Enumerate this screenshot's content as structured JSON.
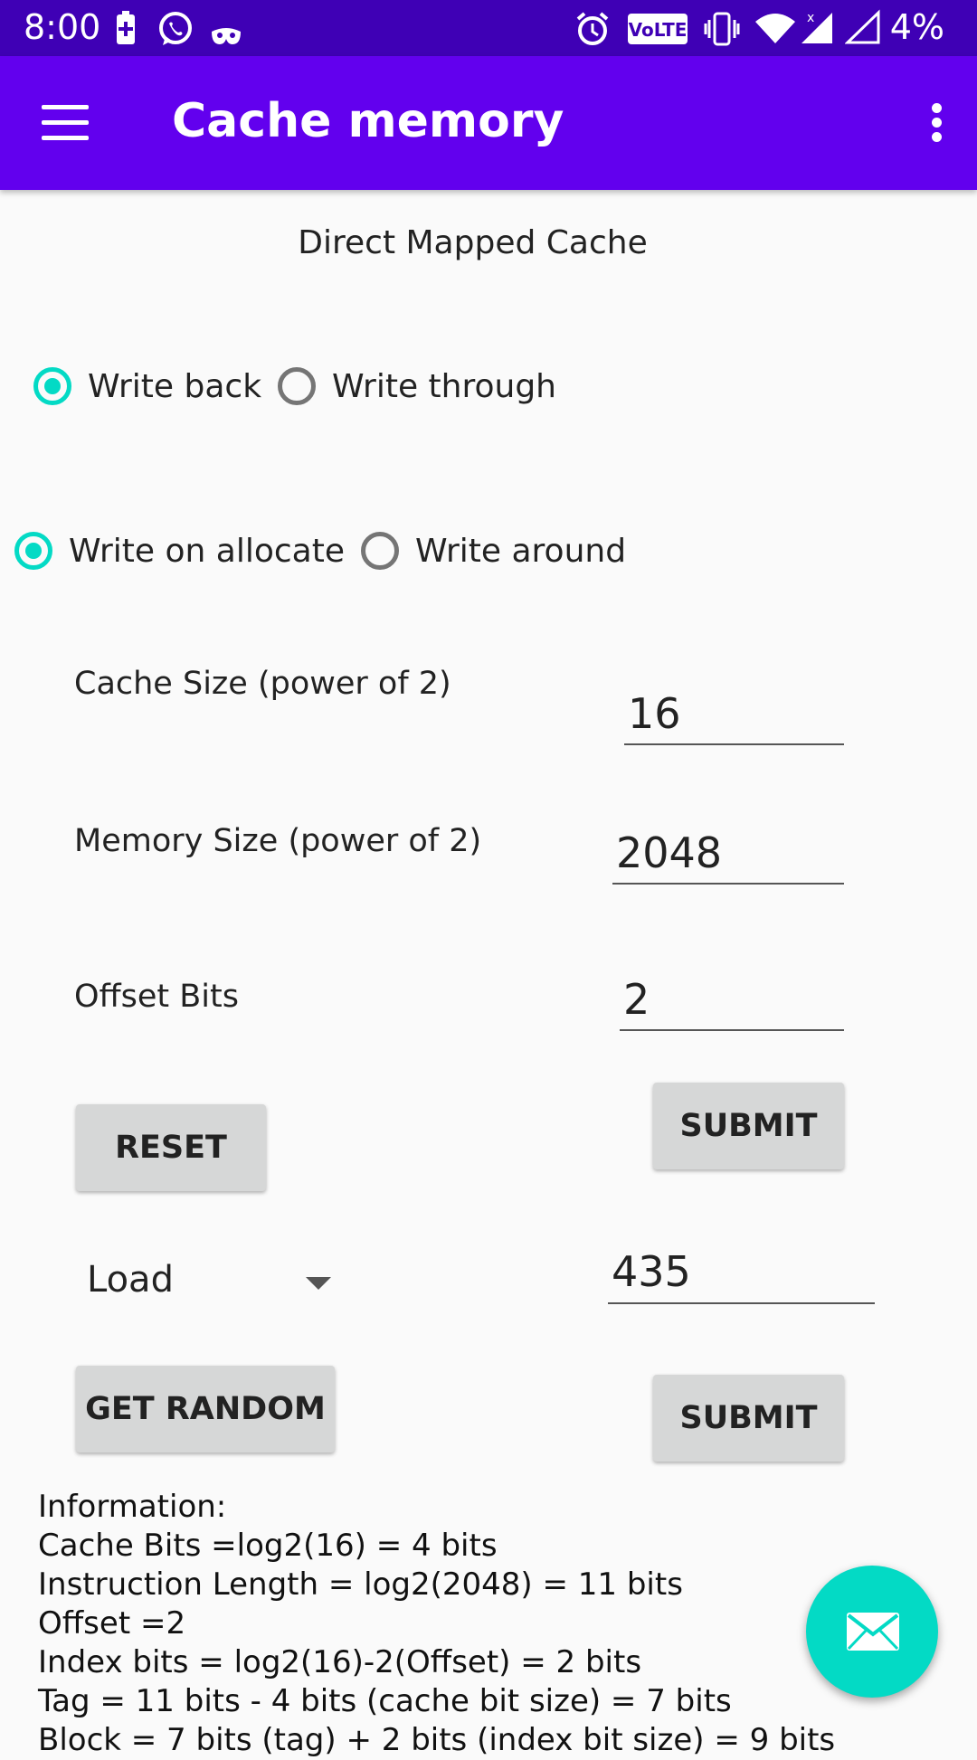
{
  "status_bar": {
    "time": "8:00",
    "battery_percent": "4%",
    "volte_label": "VoLTE",
    "icons": [
      "battery-saver-icon",
      "whatsapp-icon",
      "incognito-icon",
      "alarm-icon",
      "volte-icon",
      "vibrate-icon",
      "wifi-icon",
      "cellular-signal-icon",
      "signal-empty-icon"
    ]
  },
  "app_bar": {
    "title": "Cache memory",
    "background_color": "#6200ee",
    "status_color": "#3f00b5"
  },
  "main": {
    "section_title": "Direct Mapped Cache",
    "write_policy": {
      "options": [
        {
          "label": "Write back",
          "checked": true
        },
        {
          "label": "Write through",
          "checked": false
        }
      ]
    },
    "allocate_policy": {
      "options": [
        {
          "label": "Write on allocate",
          "checked": true
        },
        {
          "label": "Write around",
          "checked": false
        }
      ]
    },
    "fields": {
      "cache_size": {
        "label": "Cache Size (power of 2)",
        "value": "16"
      },
      "memory_size": {
        "label": "Memory Size (power of 2)",
        "value": "2048"
      },
      "offset_bits": {
        "label": "Offset Bits",
        "value": "2"
      }
    },
    "buttons": {
      "reset": "RESET",
      "submit_config": "SUBMIT",
      "get_random": "GET RANDOM",
      "submit_address": "SUBMIT"
    },
    "operation_select": {
      "selected": "Load"
    },
    "address_input": {
      "value": "435"
    },
    "info_lines": [
      "Information:",
      "Cache Bits =log2(16) = 4 bits",
      "Instruction Length = log2(2048) = 11 bits",
      "Offset =2",
      "Index bits = log2(16)-2(Offset) = 2 bits",
      "Tag = 11 bits - 4 bits (cache bit size) = 7 bits",
      "Block = 7 bits (tag) + 2 bits (index bit size) = 9 bits"
    ]
  },
  "fab": {
    "icon": "mail-icon",
    "color": "#03dac5"
  }
}
